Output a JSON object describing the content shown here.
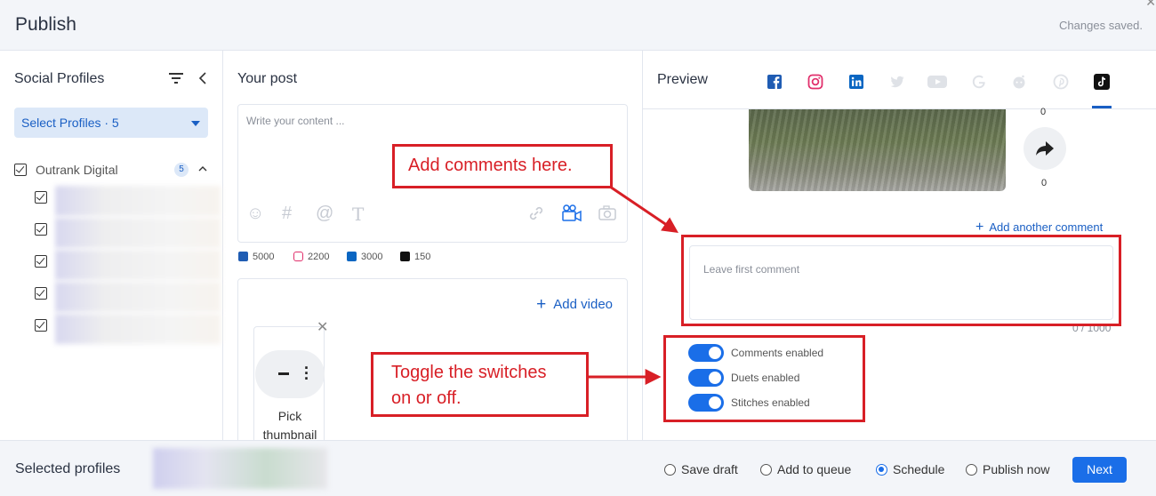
{
  "header": {
    "title": "Publish",
    "saved_status": "Changes saved."
  },
  "sidebar": {
    "title": "Social Profiles",
    "select_label": "Select Profiles · 5",
    "group": {
      "name": "Outrank Digital",
      "count": "5"
    }
  },
  "post": {
    "title": "Your post",
    "content_placeholder": "Write your content ...",
    "char_limits": [
      {
        "network": "facebook",
        "limit": "5000",
        "color": "#1f5cb3"
      },
      {
        "network": "instagram",
        "limit": "2200",
        "color": "#e1306c"
      },
      {
        "network": "linkedin",
        "limit": "3000",
        "color": "#0a66c2"
      },
      {
        "network": "tiktok",
        "limit": "150",
        "color": "#111111"
      }
    ],
    "add_video_label": "Add video",
    "thumbnail_label": "Pick thumbnail"
  },
  "preview": {
    "title": "Preview",
    "tabs": [
      "facebook",
      "instagram",
      "linkedin",
      "twitter",
      "youtube",
      "google",
      "reddit",
      "pinterest",
      "tiktok"
    ],
    "active_tab": "tiktok",
    "counts": [
      "0",
      "0"
    ],
    "add_comment_label": "Add another comment",
    "comment_placeholder": "Leave first comment",
    "char_count": "0 / 1000",
    "toggles": [
      {
        "label": "Comments enabled",
        "on": true
      },
      {
        "label": "Duets enabled",
        "on": true
      },
      {
        "label": "Stitches enabled",
        "on": true
      }
    ]
  },
  "footer": {
    "selected_label": "Selected profiles",
    "options": [
      "Save draft",
      "Add to queue",
      "Schedule",
      "Publish now"
    ],
    "selected_option": "Schedule",
    "next_label": "Next"
  },
  "annotations": {
    "comments_callout": "Add comments here.",
    "toggle_callout_line1": "Toggle the switches",
    "toggle_callout_line2": "on or off.",
    "color": "#d81f26"
  }
}
